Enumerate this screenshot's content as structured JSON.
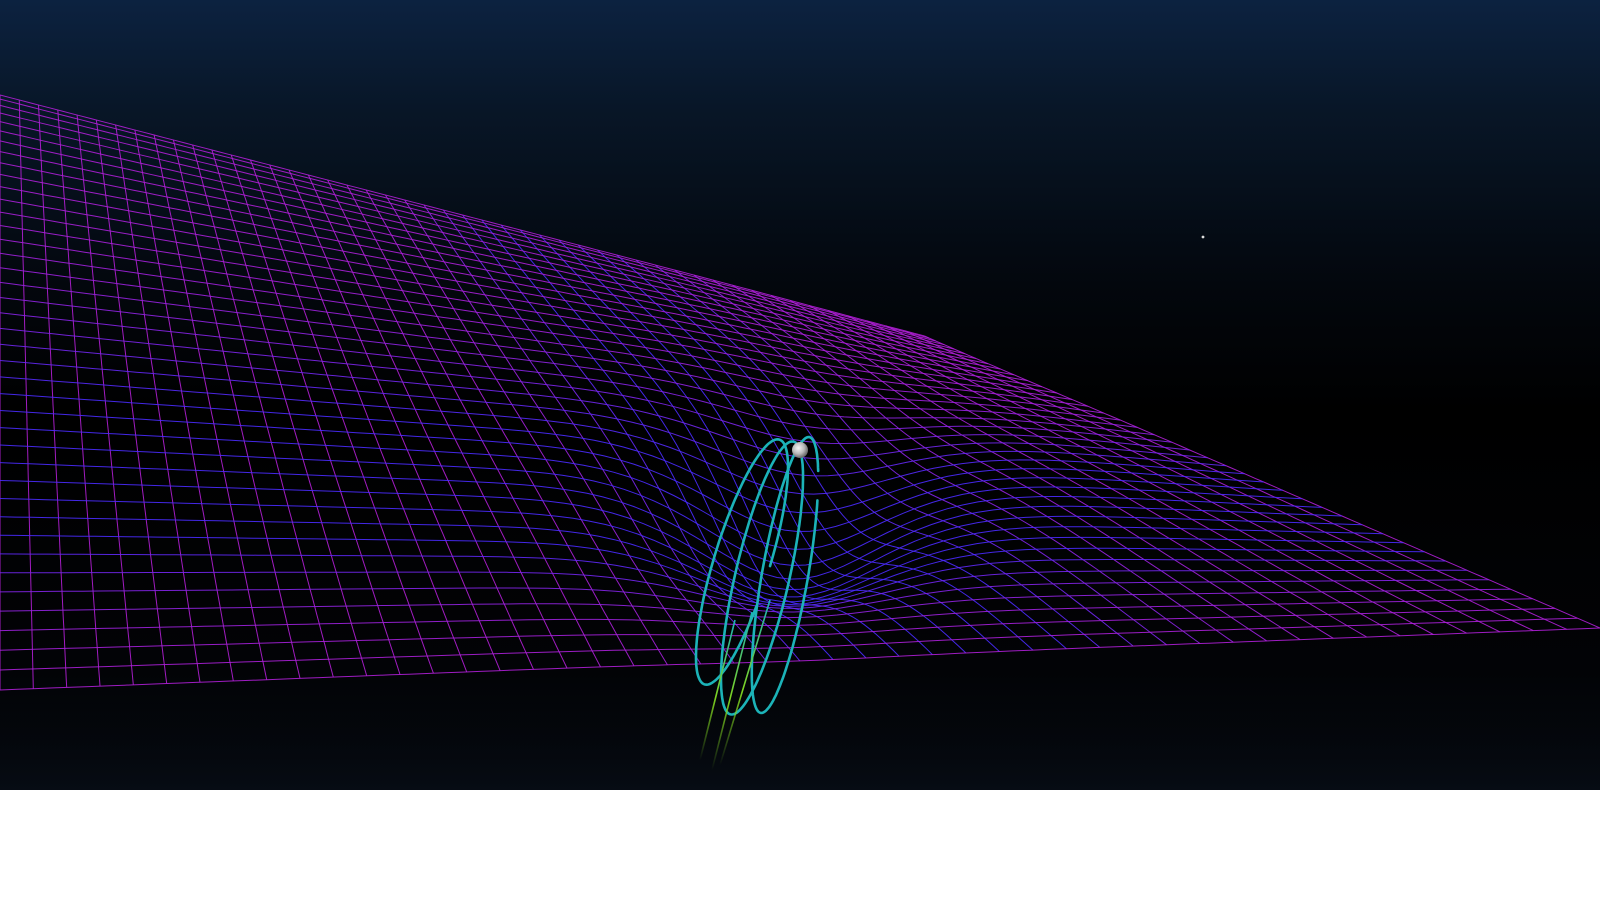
{
  "scene": {
    "sky_colors": [
      "#0c2240",
      "#000000"
    ],
    "grid_color": "#b21fd6",
    "grid_deep_color": "#4a2bff",
    "orbit_color": "#1cb3b8",
    "trail_color": "#7ed321",
    "moon_color": "#cfcfcf",
    "star_color": "#dddddd"
  }
}
